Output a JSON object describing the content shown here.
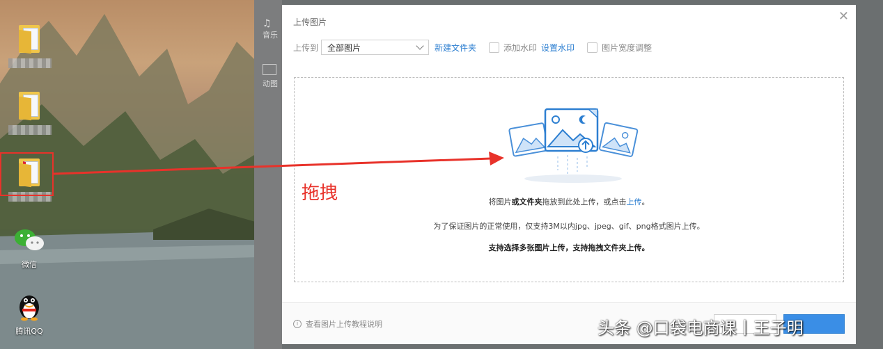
{
  "desktop": {
    "icons": [
      {
        "type": "folder",
        "label": ""
      },
      {
        "type": "folder",
        "label": ""
      },
      {
        "type": "folder",
        "label": ""
      },
      {
        "type": "wechat",
        "label": "微信"
      },
      {
        "type": "qq",
        "label": "腾讯QQ"
      }
    ]
  },
  "app_strip": {
    "items": [
      {
        "icon": "music-note-icon",
        "label": "音乐"
      },
      {
        "icon": "image-icon",
        "label": "动图"
      }
    ]
  },
  "dialog": {
    "title": "上传图片",
    "toolbar": {
      "upload_to_label": "上传到",
      "folder_select_value": "全部图片",
      "new_folder_link": "新建文件夹",
      "add_watermark_label": "添加水印",
      "set_watermark_link": "设置水印",
      "width_adjust_label": "图片宽度调整"
    },
    "dropzone": {
      "line1_pre": "将图片",
      "line1_bold": "或文件夹",
      "line1_mid": "拖放到此处上传，或点击",
      "line1_link": "上传",
      "line1_end": "。",
      "line2": "为了保证图片的正常使用，仅支持3M以内jpg、jpeg、gif、png格式图片上传。",
      "line3": "支持选择多张图片上传，支持拖拽文件夹上传。"
    },
    "footer": {
      "help_text": "查看图片上传教程说明"
    }
  },
  "annotation": {
    "drag_label": "拖拽",
    "color": "#e8322a"
  },
  "watermark": "头条 @口袋电商课丨王子明"
}
